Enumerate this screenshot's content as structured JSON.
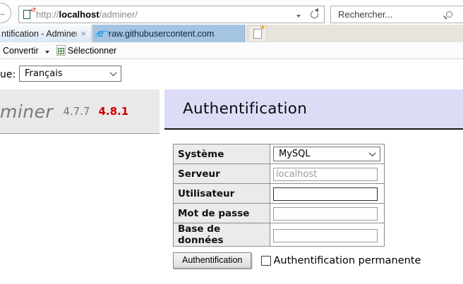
{
  "browser": {
    "url_scheme": "http://",
    "url_host": "localhost",
    "url_path": "/adminer/",
    "search_placeholder": "Rechercher...",
    "tabs": [
      {
        "label": "ntification - Adminer"
      },
      {
        "label": "raw.githubusercontent.com"
      }
    ],
    "toolbar": {
      "convert_label": "Convertir",
      "select_label": "Sélectionner"
    }
  },
  "icons": {
    "forward": "→",
    "close_tab": "×",
    "new_tab_star": "★",
    "page_marks": "<?"
  },
  "page": {
    "language_label": "ue:",
    "language_value": "Français",
    "logo_text": "miner",
    "version_current": "4.7.7",
    "version_new": "4.8.1",
    "heading": "Authentification",
    "form": {
      "rows": [
        {
          "label": "Système",
          "type": "select",
          "value": "MySQL"
        },
        {
          "label": "Serveur",
          "type": "text",
          "value": "localhost"
        },
        {
          "label": "Utilisateur",
          "type": "text",
          "value": ""
        },
        {
          "label": "Mot de passe",
          "type": "password",
          "value": ""
        },
        {
          "label": "Base de données",
          "type": "text",
          "value": ""
        }
      ],
      "submit_label": "Authentification",
      "permanent_label": "Authentification permanente"
    }
  },
  "colors": {
    "heading_bg": "#dcdcf7",
    "sidebar_bg": "#e9e9e9",
    "tab_active_bg": "#a5c4e1",
    "tab_inactive_bg": "#ddebf7",
    "tabbar_bg": "#e7e4de",
    "version_new": "#cc0000",
    "table_border": "#8c8c8c",
    "th_bg": "#ebebeb"
  }
}
